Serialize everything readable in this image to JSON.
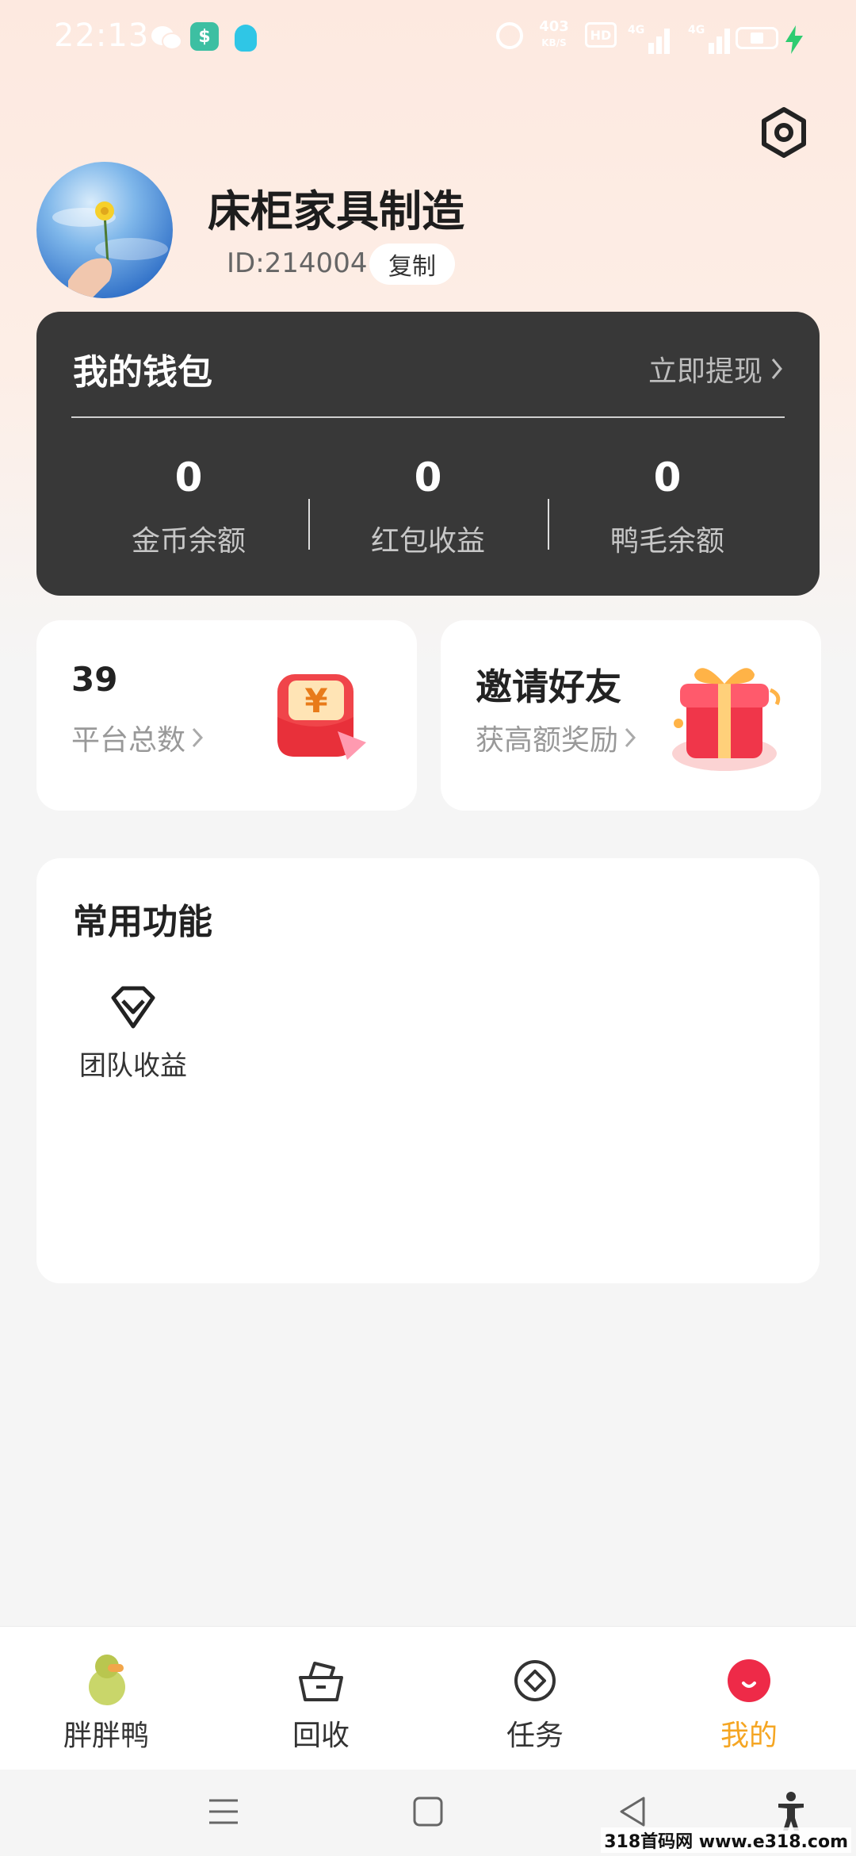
{
  "status_bar": {
    "time": "22:13",
    "net_speed_value": "403",
    "net_speed_unit": "KB/S",
    "hd_label": "HD",
    "signal1_label": "4G",
    "signal2_label": "4G",
    "icons": [
      "wechat-icon",
      "money-app-icon",
      "qq-icon",
      "alarm-icon",
      "signal-icon",
      "battery-icon",
      "charging-icon"
    ]
  },
  "profile": {
    "name": "床柜家具制造",
    "id_text": "ID:214004",
    "copy_label": "复制"
  },
  "wallet": {
    "title": "我的钱包",
    "withdraw_label": "立即提现",
    "stats": [
      {
        "value": "0",
        "label": "金币余额"
      },
      {
        "value": "0",
        "label": "红包收益"
      },
      {
        "value": "0",
        "label": "鸭毛余额"
      }
    ]
  },
  "cards": {
    "platform": {
      "value": "39",
      "label": "平台总数"
    },
    "invite": {
      "title": "邀请好友",
      "subtitle": "获高额奖励"
    }
  },
  "functions": {
    "title": "常用功能",
    "items": [
      {
        "label": "团队收益",
        "icon": "diamond-icon"
      }
    ]
  },
  "bottom_nav": {
    "items": [
      {
        "label": "胖胖鸭",
        "icon": "duck-icon"
      },
      {
        "label": "回收",
        "icon": "basket-icon"
      },
      {
        "label": "任务",
        "icon": "task-icon"
      },
      {
        "label": "我的",
        "icon": "mine-icon",
        "active": true
      }
    ],
    "active_color": "#f5a623"
  },
  "watermark": "318首码网 www.e318.com",
  "colors": {
    "header_bg": "#fde9e0",
    "wallet_bg": "#383838",
    "accent": "#f5a623",
    "mine_red": "#ee2a48"
  }
}
